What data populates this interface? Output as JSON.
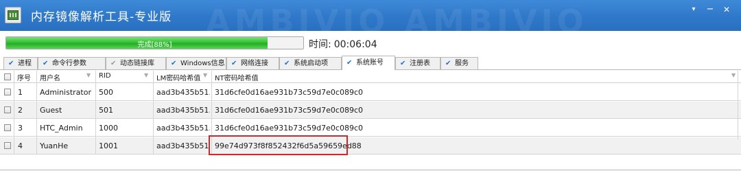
{
  "window": {
    "title": "内存镜像解析工具-专业版",
    "watermark": "AMBIVIO   AMBIVIO",
    "accent_color": "#2f78c9",
    "buttons": {
      "menu": "▾",
      "minimize": "−",
      "close": "✕"
    }
  },
  "progress": {
    "label": "完成[88%]",
    "percent": 88,
    "time_label": "时间:",
    "time_value": "00:06:04"
  },
  "tabs": [
    {
      "label": "进程",
      "checked": true,
      "active": false
    },
    {
      "label": "命令行参数",
      "checked": true,
      "active": false
    },
    {
      "label": "动态链接库",
      "checked": false,
      "active": false
    },
    {
      "label": "Windows信息",
      "checked": true,
      "active": false
    },
    {
      "label": "网络连接",
      "checked": true,
      "active": false
    },
    {
      "label": "系统启动项",
      "checked": true,
      "active": false
    },
    {
      "label": "系统账号",
      "checked": true,
      "active": true
    },
    {
      "label": "注册表",
      "checked": true,
      "active": false
    },
    {
      "label": "服务",
      "checked": true,
      "active": false
    }
  ],
  "table": {
    "headers": [
      "序号",
      "用户名",
      "RID",
      "LM密码哈希值",
      "NT密码哈希值"
    ],
    "rows": [
      [
        "1",
        "Administrator",
        "500",
        "aad3b435b51...",
        "31d6cfe0d16ae931b73c59d7e0c089c0"
      ],
      [
        "2",
        "Guest",
        "501",
        "aad3b435b51...",
        "31d6cfe0d16ae931b73c59d7e0c089c0"
      ],
      [
        "3",
        "HTC_Admin",
        "1000",
        "aad3b435b51...",
        "31d6cfe0d16ae931b73c59d7e0c089c0"
      ],
      [
        "4",
        "YuanHe",
        "1001",
        "aad3b435b51...",
        "99e74d973f8f852432f6d5a59659ed88"
      ]
    ],
    "highlight_color": "#d0262c"
  }
}
